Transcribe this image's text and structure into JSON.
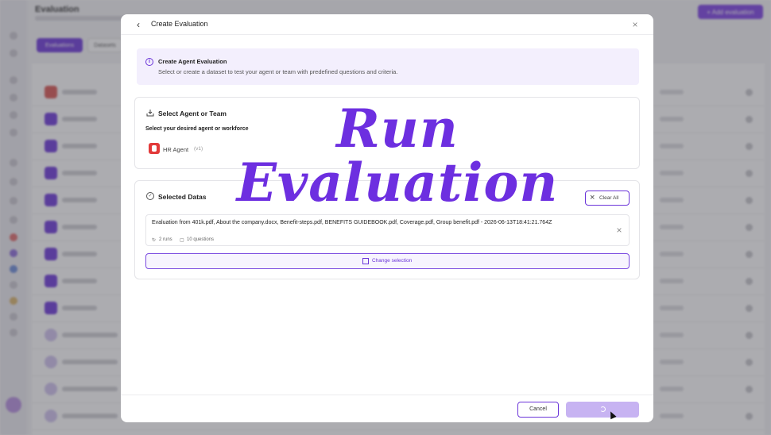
{
  "background": {
    "title": "Evaluation",
    "add_button": "+ Add evaluation",
    "tabs": [
      "Evaluations",
      "Datasets"
    ]
  },
  "modal": {
    "back_label": "‹",
    "title": "Create Evaluation",
    "close_label": "×"
  },
  "info": {
    "icon": "i",
    "title": "Create Agent Evaluation",
    "description": "Select or create a dataset to test your agent or team with predefined questions and criteria."
  },
  "agent_section": {
    "title": "Select Agent or Team",
    "subtitle": "Select your desired agent or workforce",
    "agent_name": "HR Agent",
    "agent_version": "(v1)"
  },
  "dataset_section": {
    "title": "Selected Datas",
    "clear_all": "Clear All",
    "dataset_name": "Evaluation from 401k.pdf, About the company.docx, Benefit-steps.pdf, BENEFITS GUIDEBOOK.pdf, Coverage.pdf, Group benefit.pdf - 2026-06-13T18:41:21.764Z",
    "runs": "2 runs",
    "questions": "10 questions",
    "change_selection": "Change selection"
  },
  "footer": {
    "cancel": "Cancel"
  },
  "headline": {
    "line1": "Run",
    "line2": "Evaluation"
  },
  "colors": {
    "accent": "#6b35d9",
    "headline": "#6d2fe0",
    "info_bg": "#f3effd"
  }
}
